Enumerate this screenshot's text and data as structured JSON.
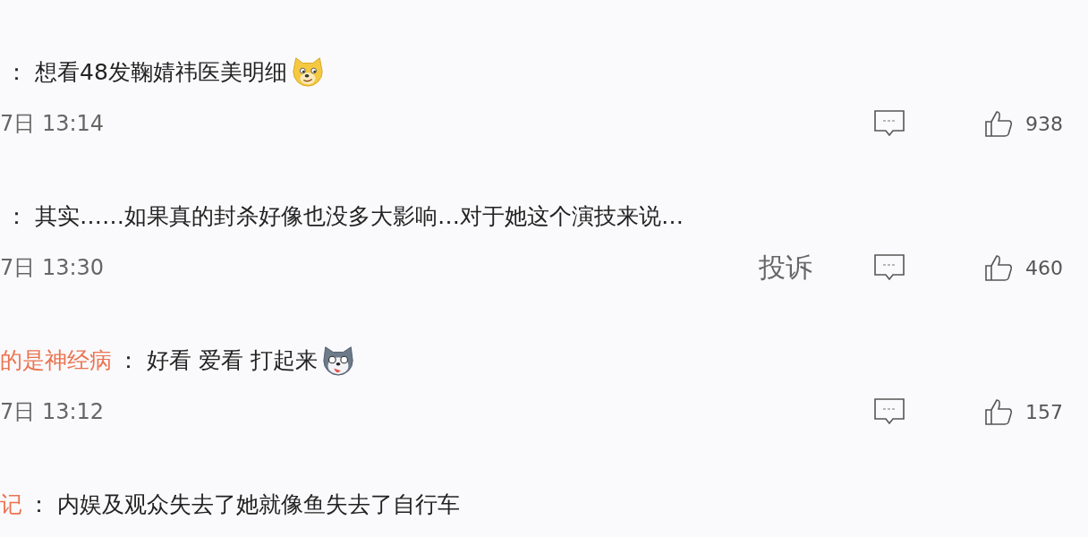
{
  "comments": [
    {
      "colon": "：",
      "text": "想看48发鞠婧祎医美明细",
      "emoji": {
        "kind": "doge"
      },
      "time": "7日 13:14",
      "likes": "938"
    },
    {
      "colon": "：",
      "text": "其实……如果真的封杀好像也没多大影响…对于她这个演技来说…",
      "time": "7日 13:30",
      "report": "投诉",
      "likes": "460"
    },
    {
      "user": "的是神经病",
      "colon": "：",
      "text": "好看 爱看 打起来",
      "emoji": {
        "kind": "husky"
      },
      "time": "7日 13:12",
      "likes": "157"
    },
    {
      "user": "记",
      "colon": "：",
      "text": "内娱及观众失去了她就像鱼失去了自行车"
    }
  ]
}
